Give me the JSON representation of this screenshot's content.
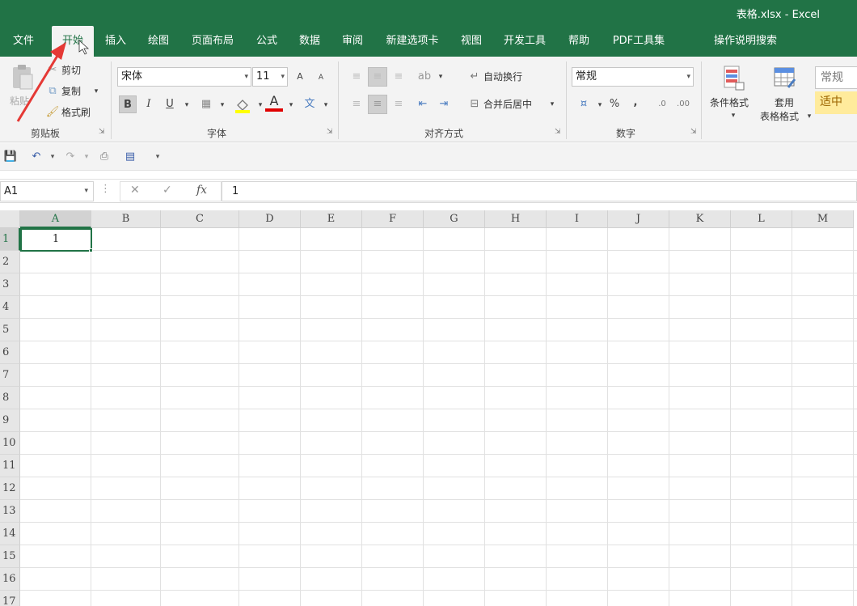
{
  "window": {
    "title": "表格.xlsx  -  Excel"
  },
  "tabs": [
    "文件",
    "开始",
    "插入",
    "绘图",
    "页面布局",
    "公式",
    "数据",
    "审阅",
    "新建选项卡",
    "视图",
    "开发工具",
    "帮助",
    "PDF工具集"
  ],
  "search": {
    "label": "操作说明搜索"
  },
  "clipboard": {
    "paste": "粘贴",
    "cut": "剪切",
    "copy": "复制",
    "format_painter": "格式刷",
    "group": "剪贴板"
  },
  "font": {
    "name": "宋体",
    "size": "11",
    "bold": "B",
    "italic": "I",
    "underline": "U",
    "color_letter": "A",
    "group": "字体",
    "grow": "A",
    "shrink": "A"
  },
  "alignment": {
    "wrap": "自动换行",
    "merge": "合并后居中",
    "group": "对齐方式"
  },
  "number": {
    "format": "常规",
    "percent": "%",
    "comma": ",",
    "group": "数字"
  },
  "styles": {
    "conditional": "条件格式",
    "table_l1": "套用",
    "table_l2": "表格格式",
    "normal": "常规",
    "neutral": "适中"
  },
  "namebox": "A1",
  "formula": {
    "fx": "fx",
    "value": "1"
  },
  "grid": {
    "columns": [
      "A",
      "B",
      "C",
      "D",
      "E",
      "F",
      "G",
      "H",
      "I",
      "J",
      "K",
      "L",
      "M"
    ],
    "rows": [
      "1",
      "2",
      "3",
      "4",
      "5",
      "6",
      "7",
      "8",
      "9",
      "10",
      "11",
      "12",
      "13",
      "14",
      "15",
      "16",
      "17"
    ],
    "a1_value": "1"
  },
  "colors": {
    "accent": "#217346",
    "annotation": "#e53935"
  }
}
